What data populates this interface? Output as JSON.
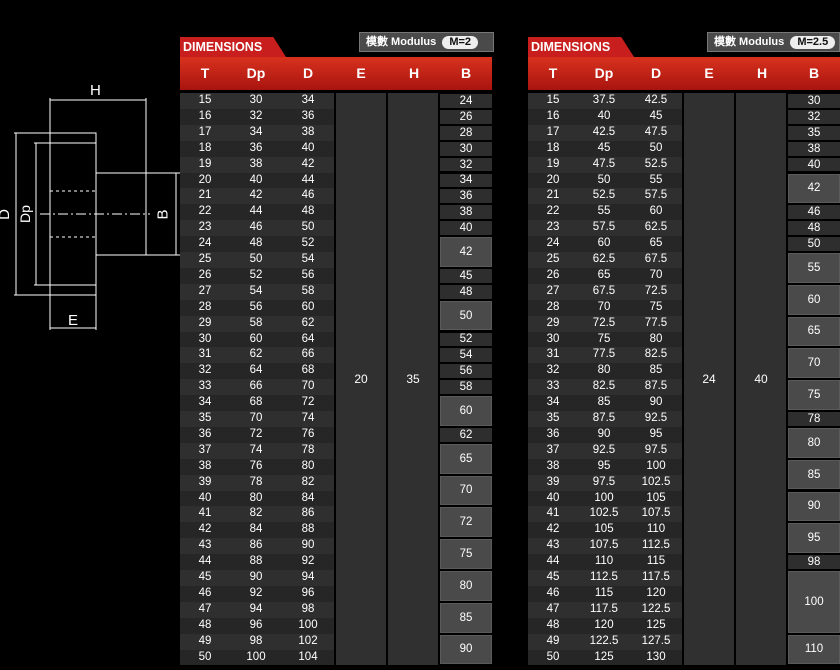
{
  "diagram_labels": {
    "H": "H",
    "D": "D",
    "Dp": "Dp",
    "B": "B",
    "E": "E"
  },
  "headers": [
    "T",
    "Dp",
    "D",
    "E",
    "H",
    "B"
  ],
  "left": {
    "title": "DIMENSIONS",
    "modulus_label": "模數 Modulus",
    "modulus_value": "M=2",
    "E": "20",
    "H": "35",
    "rows": [
      [
        "15",
        "30",
        "34"
      ],
      [
        "16",
        "32",
        "36"
      ],
      [
        "17",
        "34",
        "38"
      ],
      [
        "18",
        "36",
        "40"
      ],
      [
        "19",
        "38",
        "42"
      ],
      [
        "20",
        "40",
        "44"
      ],
      [
        "21",
        "42",
        "46"
      ],
      [
        "22",
        "44",
        "48"
      ],
      [
        "23",
        "46",
        "50"
      ],
      [
        "24",
        "48",
        "52"
      ],
      [
        "25",
        "50",
        "54"
      ],
      [
        "26",
        "52",
        "56"
      ],
      [
        "27",
        "54",
        "58"
      ],
      [
        "28",
        "56",
        "60"
      ],
      [
        "29",
        "58",
        "62"
      ],
      [
        "30",
        "60",
        "64"
      ],
      [
        "31",
        "62",
        "66"
      ],
      [
        "32",
        "64",
        "68"
      ],
      [
        "33",
        "66",
        "70"
      ],
      [
        "34",
        "68",
        "72"
      ],
      [
        "35",
        "70",
        "74"
      ],
      [
        "36",
        "72",
        "76"
      ],
      [
        "37",
        "74",
        "78"
      ],
      [
        "38",
        "76",
        "80"
      ],
      [
        "39",
        "78",
        "82"
      ],
      [
        "40",
        "80",
        "84"
      ],
      [
        "41",
        "82",
        "86"
      ],
      [
        "42",
        "84",
        "88"
      ],
      [
        "43",
        "86",
        "90"
      ],
      [
        "44",
        "88",
        "92"
      ],
      [
        "45",
        "90",
        "94"
      ],
      [
        "46",
        "92",
        "96"
      ],
      [
        "47",
        "94",
        "98"
      ],
      [
        "48",
        "96",
        "100"
      ],
      [
        "49",
        "98",
        "102"
      ],
      [
        "50",
        "100",
        "104"
      ]
    ],
    "B": [
      {
        "v": "24",
        "start": 0,
        "span": 1
      },
      {
        "v": "26",
        "start": 1,
        "span": 1
      },
      {
        "v": "28",
        "start": 2,
        "span": 1
      },
      {
        "v": "30",
        "start": 3,
        "span": 1
      },
      {
        "v": "32",
        "start": 4,
        "span": 1
      },
      {
        "v": "34",
        "start": 5,
        "span": 1
      },
      {
        "v": "36",
        "start": 6,
        "span": 1
      },
      {
        "v": "38",
        "start": 7,
        "span": 1
      },
      {
        "v": "40",
        "start": 8,
        "span": 1
      },
      {
        "v": "42",
        "start": 9,
        "span": 2
      },
      {
        "v": "45",
        "start": 11,
        "span": 1
      },
      {
        "v": "48",
        "start": 12,
        "span": 1
      },
      {
        "v": "50",
        "start": 13,
        "span": 2
      },
      {
        "v": "52",
        "start": 15,
        "span": 1
      },
      {
        "v": "54",
        "start": 16,
        "span": 1
      },
      {
        "v": "56",
        "start": 17,
        "span": 1
      },
      {
        "v": "58",
        "start": 18,
        "span": 1
      },
      {
        "v": "60",
        "start": 19,
        "span": 2
      },
      {
        "v": "62",
        "start": 21,
        "span": 1
      },
      {
        "v": "65",
        "start": 22,
        "span": 2
      },
      {
        "v": "70",
        "start": 24,
        "span": 2
      },
      {
        "v": "72",
        "start": 26,
        "span": 2
      },
      {
        "v": "75",
        "start": 28,
        "span": 2
      },
      {
        "v": "80",
        "start": 30,
        "span": 2
      },
      {
        "v": "85",
        "start": 32,
        "span": 2
      },
      {
        "v": "90",
        "start": 34,
        "span": 2
      }
    ]
  },
  "right": {
    "title": "DIMENSIONS",
    "modulus_label": "模數 Modulus",
    "modulus_value": "M=2.5",
    "E": "24",
    "H": "40",
    "rows": [
      [
        "15",
        "37.5",
        "42.5"
      ],
      [
        "16",
        "40",
        "45"
      ],
      [
        "17",
        "42.5",
        "47.5"
      ],
      [
        "18",
        "45",
        "50"
      ],
      [
        "19",
        "47.5",
        "52.5"
      ],
      [
        "20",
        "50",
        "55"
      ],
      [
        "21",
        "52.5",
        "57.5"
      ],
      [
        "22",
        "55",
        "60"
      ],
      [
        "23",
        "57.5",
        "62.5"
      ],
      [
        "24",
        "60",
        "65"
      ],
      [
        "25",
        "62.5",
        "67.5"
      ],
      [
        "26",
        "65",
        "70"
      ],
      [
        "27",
        "67.5",
        "72.5"
      ],
      [
        "28",
        "70",
        "75"
      ],
      [
        "29",
        "72.5",
        "77.5"
      ],
      [
        "30",
        "75",
        "80"
      ],
      [
        "31",
        "77.5",
        "82.5"
      ],
      [
        "32",
        "80",
        "85"
      ],
      [
        "33",
        "82.5",
        "87.5"
      ],
      [
        "34",
        "85",
        "90"
      ],
      [
        "35",
        "87.5",
        "92.5"
      ],
      [
        "36",
        "90",
        "95"
      ],
      [
        "37",
        "92.5",
        "97.5"
      ],
      [
        "38",
        "95",
        "100"
      ],
      [
        "39",
        "97.5",
        "102.5"
      ],
      [
        "40",
        "100",
        "105"
      ],
      [
        "41",
        "102.5",
        "107.5"
      ],
      [
        "42",
        "105",
        "110"
      ],
      [
        "43",
        "107.5",
        "112.5"
      ],
      [
        "44",
        "110",
        "115"
      ],
      [
        "45",
        "112.5",
        "117.5"
      ],
      [
        "46",
        "115",
        "120"
      ],
      [
        "47",
        "117.5",
        "122.5"
      ],
      [
        "48",
        "120",
        "125"
      ],
      [
        "49",
        "122.5",
        "127.5"
      ],
      [
        "50",
        "125",
        "130"
      ]
    ],
    "B": [
      {
        "v": "30",
        "start": 0,
        "span": 1
      },
      {
        "v": "32",
        "start": 1,
        "span": 1
      },
      {
        "v": "35",
        "start": 2,
        "span": 1
      },
      {
        "v": "38",
        "start": 3,
        "span": 1
      },
      {
        "v": "40",
        "start": 4,
        "span": 1
      },
      {
        "v": "42",
        "start": 5,
        "span": 2
      },
      {
        "v": "46",
        "start": 7,
        "span": 1
      },
      {
        "v": "48",
        "start": 8,
        "span": 1
      },
      {
        "v": "50",
        "start": 9,
        "span": 1
      },
      {
        "v": "55",
        "start": 10,
        "span": 2
      },
      {
        "v": "60",
        "start": 12,
        "span": 2
      },
      {
        "v": "65",
        "start": 14,
        "span": 2
      },
      {
        "v": "70",
        "start": 16,
        "span": 2
      },
      {
        "v": "75",
        "start": 18,
        "span": 2
      },
      {
        "v": "78",
        "start": 20,
        "span": 1
      },
      {
        "v": "80",
        "start": 21,
        "span": 2
      },
      {
        "v": "85",
        "start": 23,
        "span": 2
      },
      {
        "v": "90",
        "start": 25,
        "span": 2
      },
      {
        "v": "95",
        "start": 27,
        "span": 2
      },
      {
        "v": "98",
        "start": 29,
        "span": 1
      },
      {
        "v": "100",
        "start": 30,
        "span": 4
      },
      {
        "v": "110",
        "start": 34,
        "span": 2
      }
    ]
  }
}
